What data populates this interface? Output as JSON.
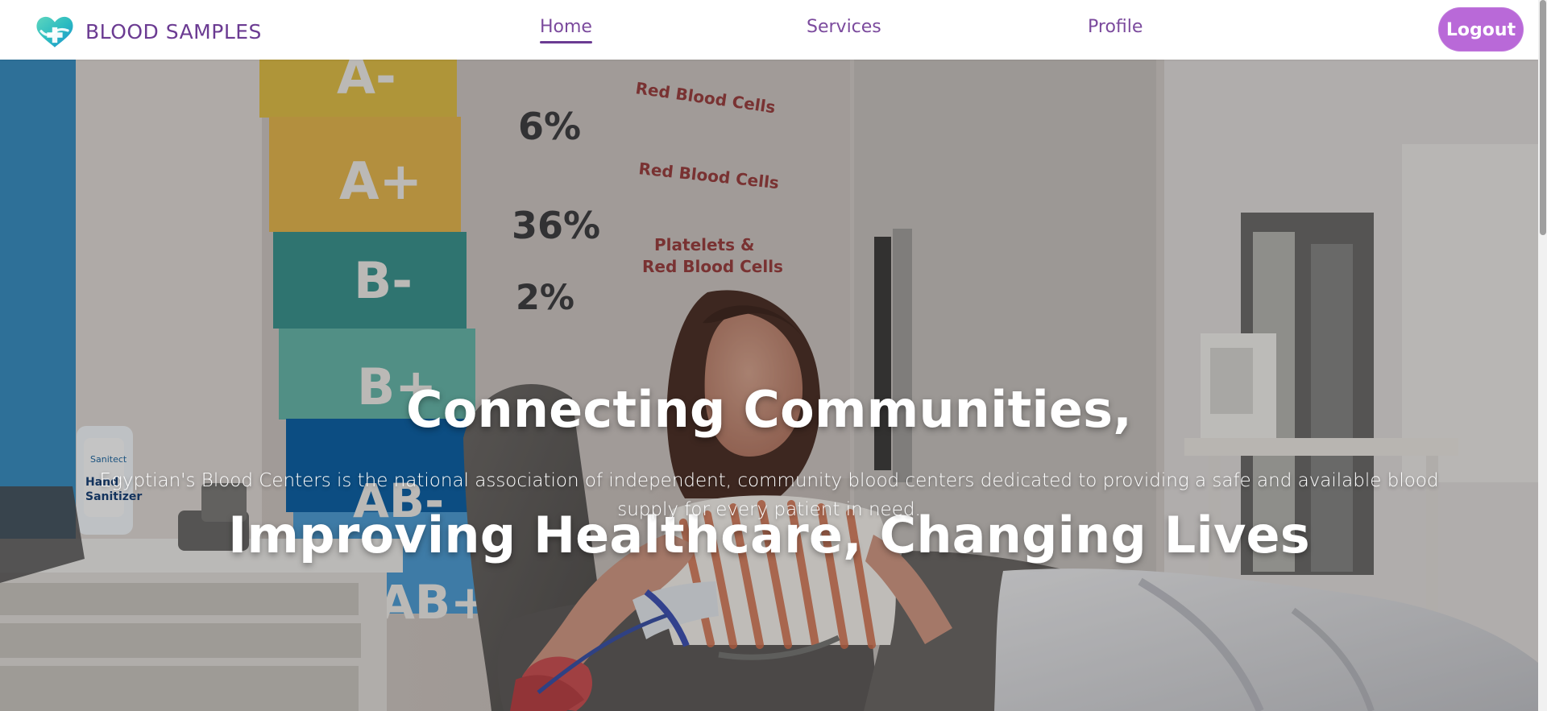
{
  "brand": {
    "name": "BLOOD SAMPLES",
    "icon": "heart-drop-icon"
  },
  "nav": {
    "home": "Home",
    "services": "Services",
    "profile": "Profile"
  },
  "actions": {
    "logout": "Logout"
  },
  "hero": {
    "title_line_1": "Connecting Communities,",
    "title_line_2": "Improving Healthcare, Changing Lives",
    "subtitle": "Egyptian's Blood Centers is the national association of independent, community blood centers dedicated to providing a safe and available blood supply for every patient in need."
  },
  "poster": {
    "blood_types": [
      "A-",
      "A+",
      "B-",
      "B+",
      "AB-",
      "AB+"
    ],
    "percentages": [
      "6%",
      "36%",
      "2%"
    ],
    "notes": [
      "Red Blood Cells",
      "Red Blood Cells",
      "Platelets & Red Blood Cells"
    ]
  },
  "sanitizer": {
    "label": "Hand Sanitizer",
    "brand": "Sanitect"
  },
  "colors": {
    "brand_purple": "#6b3b92",
    "nav_purple": "#7b4a9d",
    "logout_purple": "#b969d8",
    "logo_teal": "#2cbcc0",
    "logo_blue": "#1b8fd1"
  }
}
